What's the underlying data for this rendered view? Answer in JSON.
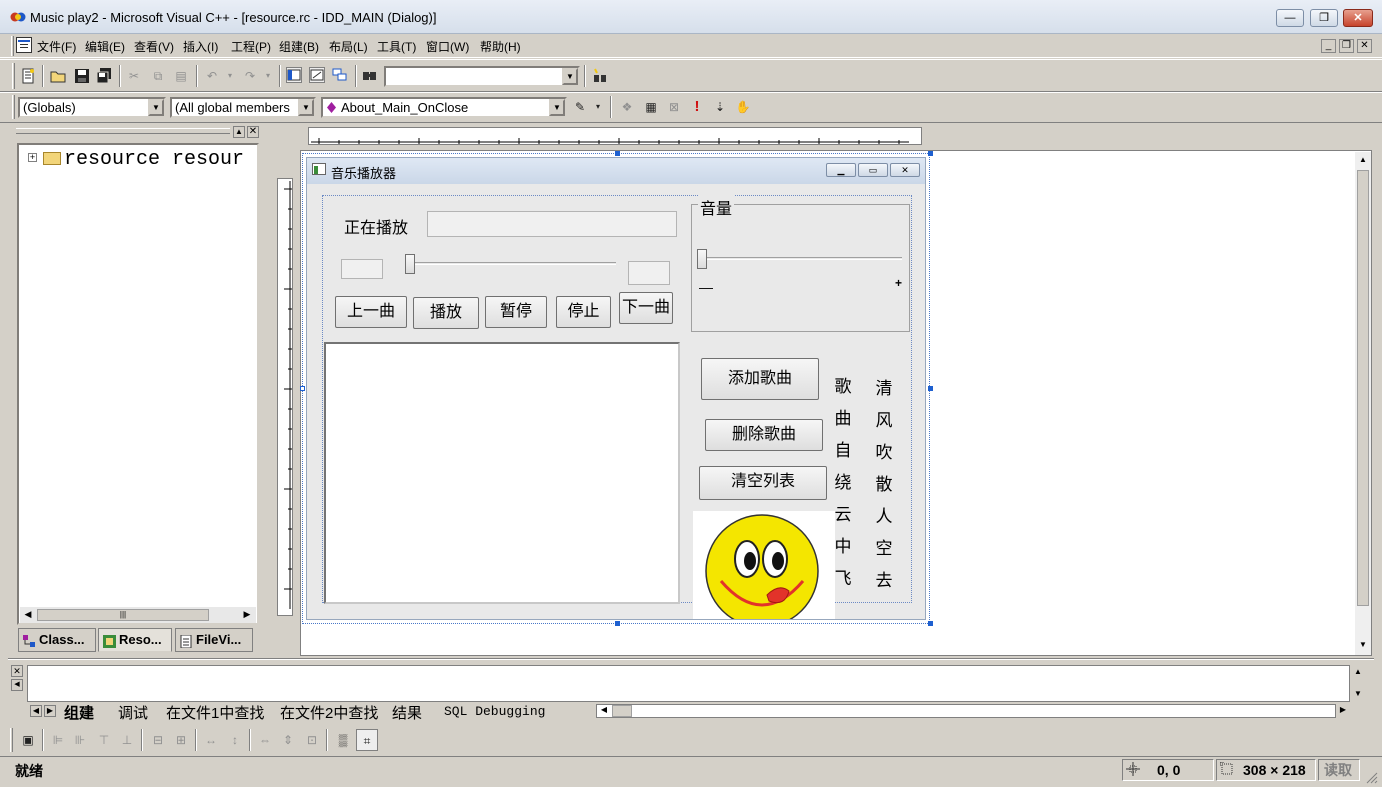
{
  "window": {
    "title": "Music play2 - Microsoft Visual C++ - [resource.rc - IDD_MAIN (Dialog)]",
    "minimize": "—",
    "restore": "❐",
    "close": "✕"
  },
  "menu": {
    "items": [
      "文件(F)",
      "编辑(E)",
      "查看(V)",
      "插入(I)",
      "工程(P)",
      "组建(B)",
      "布局(L)",
      "工具(T)",
      "窗口(W)",
      "帮助(H)"
    ],
    "mdi_minimize": "_",
    "mdi_restore": "❐",
    "mdi_close": "✕"
  },
  "toolbar1": {
    "find_combo_value": "",
    "icons": [
      "new-file-icon",
      "open-folder-icon",
      "save-icon",
      "save-all-icon",
      "cut-icon",
      "copy-icon",
      "paste-icon",
      "undo-icon",
      "redo-icon",
      "workspace-icon",
      "output-icon",
      "window-list-icon",
      "find-in-files-icon",
      "search-icon"
    ]
  },
  "toolbar2": {
    "globals_combo": "(Globals)",
    "members_combo": "(All global members",
    "function_combo": "About_Main_OnClose",
    "icons": [
      "wizard-icon",
      "compile-icon",
      "build-icon",
      "stop-build-icon",
      "execute-icon",
      "go-icon",
      "breakpoint-icon"
    ]
  },
  "workspace": {
    "tree_root": "resource resour",
    "tabs": [
      "Class...",
      "Reso...",
      "FileVi..."
    ]
  },
  "dialog": {
    "title": "音乐播放器",
    "now_playing_label": "正在播放",
    "now_playing_value": "",
    "volume_group": "音量",
    "volume_min": "—",
    "volume_max": "+",
    "buttons": {
      "prev": "上一曲",
      "play": "播放",
      "pause": "暂停",
      "stop": "停止",
      "next": "下一曲",
      "add": "添加歌曲",
      "delete": "删除歌曲",
      "clear": "清空列表"
    },
    "lyrics_col1": [
      "歌",
      "曲",
      "自",
      "绕",
      "云",
      "中",
      "飞"
    ],
    "lyrics_col2": [
      "清",
      "风",
      "吹",
      "散",
      "人",
      "空",
      "去"
    ],
    "progress_fraction": 0.0,
    "volume_fraction": 0.0
  },
  "output": {
    "tabs": [
      "组建",
      "调试",
      "在文件1中查找",
      "在文件2中查找",
      "结果",
      "SQL Debugging"
    ]
  },
  "status": {
    "text": "就绪",
    "position": "0, 0",
    "size": "308 × 218",
    "mode": "读取"
  },
  "colors": {
    "face": "#d4d0c8",
    "dialog_face": "#e9e9e9",
    "smiley_yellow": "#f4e600",
    "tongue": "#e2332a"
  }
}
